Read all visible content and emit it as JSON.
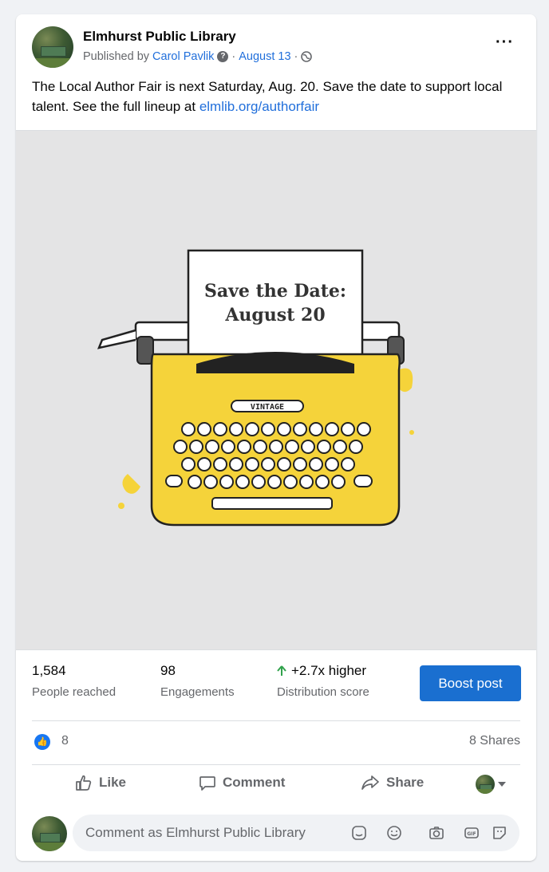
{
  "post": {
    "page_name": "Elmhurst Public Library",
    "published_by_prefix": "Published by",
    "publisher": "Carol Pavlik",
    "separator": "·",
    "date": "August 13",
    "text_before_link": "The Local Author Fair is next Saturday, Aug. 20. Save the date to support local talent. See the full lineup at ",
    "link_text": "elmlib.org/authorfair",
    "more_label": "···",
    "privacy_icon": "globe-icon",
    "info_icon": "question-icon"
  },
  "image": {
    "paper_line1": "Save the Date:",
    "paper_line2": "August 20",
    "brand": "VINTAGE",
    "colors": {
      "body": "#f5d33a",
      "background": "#e4e4e5",
      "ink": "#222222"
    }
  },
  "stats": {
    "reached_value": "1,584",
    "reached_label": "People reached",
    "engagements_value": "98",
    "engagements_label": "Engagements",
    "distribution_value": "+2.7x higher",
    "distribution_label": "Distribution score",
    "boost_label": "Boost post"
  },
  "reactions": {
    "like_count": "8",
    "shares": "8 Shares"
  },
  "actions": {
    "like": "Like",
    "comment": "Comment",
    "share": "Share"
  },
  "comment": {
    "placeholder": "Comment as Elmhurst Public Library"
  },
  "colors": {
    "accent": "#1877f2",
    "link": "#216fdb",
    "boost": "#1a6fd0",
    "up_arrow": "#31a24c"
  }
}
